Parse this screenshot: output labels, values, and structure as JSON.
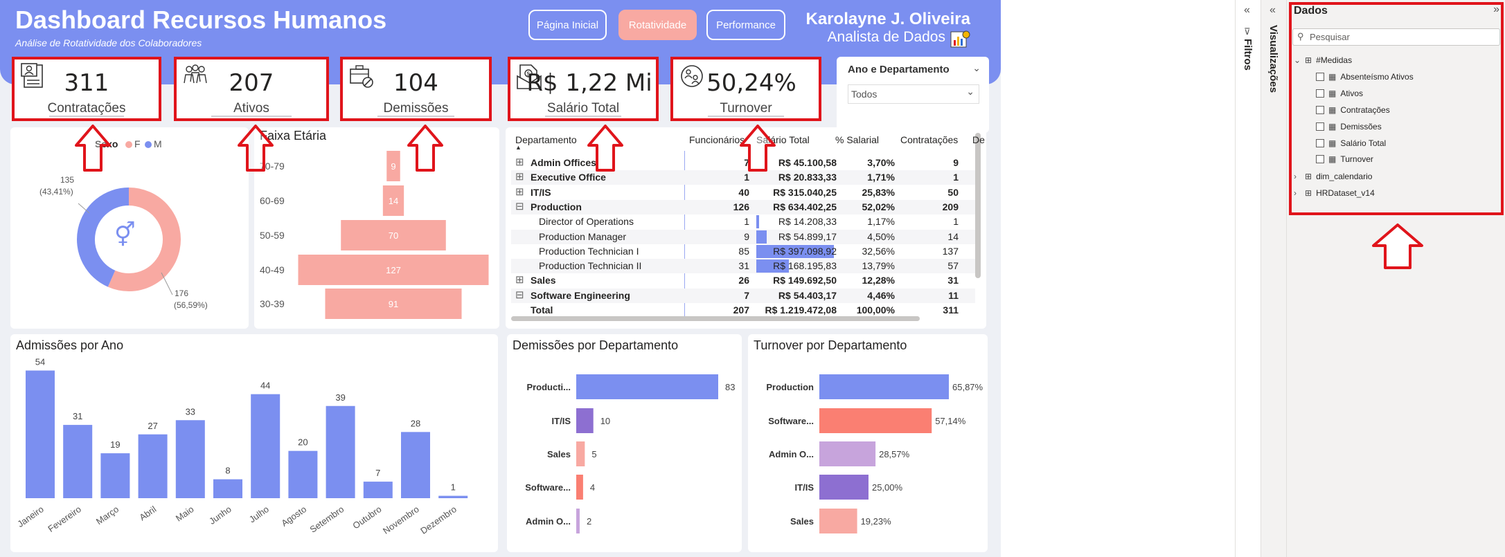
{
  "header": {
    "title": "Dashboard Recursos Humanos",
    "subtitle": "Análise de Rotatividade dos Colaboradores",
    "nav": [
      {
        "label": "Página Inicial",
        "active": false
      },
      {
        "label": "Rotatividade",
        "active": true
      },
      {
        "label": "Performance",
        "active": false
      }
    ],
    "user_name": "Karolayne J. Oliveira",
    "user_role": "Analista de Dados"
  },
  "kpis": [
    {
      "value": "311",
      "label": "Contratações",
      "icon": "hiring-doc-icon"
    },
    {
      "value": "207",
      "label": "Ativos",
      "icon": "people-group-icon"
    },
    {
      "value": "104",
      "label": "Demissões",
      "icon": "briefcase-cancel-icon"
    },
    {
      "value": "R$ 1,22 Mi",
      "label": "Salário Total",
      "icon": "money-doc-icon"
    },
    {
      "value": "50,24%",
      "label": "Turnover",
      "icon": "people-cycle-icon"
    }
  ],
  "slicer": {
    "title": "Ano e Departamento",
    "value": "Todos"
  },
  "sex_chart": {
    "legend_title": "Sexo",
    "legend": [
      {
        "label": "F",
        "color": "#f8a9a2"
      },
      {
        "label": "M",
        "color": "#7b8ff0"
      }
    ],
    "label_m": "135",
    "label_m_pct": "(43,41%)",
    "label_f": "176",
    "label_f_pct": "(56,59%)"
  },
  "age_chart": {
    "title": "Faixa Etária"
  },
  "table": {
    "headers": [
      "Departamento",
      "Funcionários",
      "Salário Total",
      "% Salarial",
      "Contratações",
      "De"
    ],
    "rows": [
      {
        "dept": "Admin Offices",
        "func": "7",
        "sal": "R$ 45.100,58",
        "pct": "3,70%",
        "contr": "9",
        "level": 0,
        "expand": "⊞",
        "bar": 0
      },
      {
        "dept": "Executive Office",
        "func": "1",
        "sal": "R$ 20.833,33",
        "pct": "1,71%",
        "contr": "1",
        "level": 0,
        "expand": "⊞",
        "bar": 0
      },
      {
        "dept": "IT/IS",
        "func": "40",
        "sal": "R$ 315.040,25",
        "pct": "25,83%",
        "contr": "50",
        "level": 0,
        "expand": "⊞",
        "bar": 0
      },
      {
        "dept": "Production",
        "func": "126",
        "sal": "R$ 634.402,25",
        "pct": "52,02%",
        "contr": "209",
        "level": 0,
        "expand": "⊟",
        "bar": 0
      },
      {
        "dept": "Director of Operations",
        "func": "1",
        "sal": "R$ 14.208,33",
        "pct": "1,17%",
        "contr": "1",
        "level": 1,
        "expand": "",
        "bar": 14208.33
      },
      {
        "dept": "Production Manager",
        "func": "9",
        "sal": "R$ 54.899,17",
        "pct": "4,50%",
        "contr": "14",
        "level": 1,
        "expand": "",
        "bar": 54899.17
      },
      {
        "dept": "Production Technician I",
        "func": "85",
        "sal": "R$ 397.098,92",
        "pct": "32,56%",
        "contr": "137",
        "level": 1,
        "expand": "",
        "bar": 397098.92
      },
      {
        "dept": "Production Technician II",
        "func": "31",
        "sal": "R$ 168.195,83",
        "pct": "13,79%",
        "contr": "57",
        "level": 1,
        "expand": "",
        "bar": 168195.83
      },
      {
        "dept": "Sales",
        "func": "26",
        "sal": "R$ 149.692,50",
        "pct": "12,28%",
        "contr": "31",
        "level": 0,
        "expand": "⊞",
        "bar": 0
      },
      {
        "dept": "Software Engineering",
        "func": "7",
        "sal": "R$ 54.403,17",
        "pct": "4,46%",
        "contr": "11",
        "level": 0,
        "expand": "⊟",
        "bar": 0
      },
      {
        "dept": "Total",
        "func": "207",
        "sal": "R$ 1.219.472,08",
        "pct": "100,00%",
        "contr": "311",
        "level": 0,
        "expand": "",
        "bar": 0
      }
    ]
  },
  "chart_titles": {
    "admissions": "Admissões por Ano",
    "dismissals": "Demissões por Departamento",
    "turnover": "Turnover por Departamento"
  },
  "panes": {
    "filters": "Filtros",
    "visualizations": "Visualizações",
    "data": "Dados",
    "search_placeholder": "Pesquisar",
    "tree": [
      {
        "label": "#Medidas",
        "level": 0,
        "kind": "table"
      },
      {
        "label": "Absenteísmo Ativos",
        "level": 1,
        "kind": "measure"
      },
      {
        "label": "Ativos",
        "level": 1,
        "kind": "measure"
      },
      {
        "label": "Contratações",
        "level": 1,
        "kind": "measure"
      },
      {
        "label": "Demissões",
        "level": 1,
        "kind": "measure"
      },
      {
        "label": "Salário Total",
        "level": 1,
        "kind": "measure"
      },
      {
        "label": "Turnover",
        "level": 1,
        "kind": "measure"
      },
      {
        "label": "dim_calendario",
        "level": 0,
        "kind": "table"
      },
      {
        "label": "HRDataset_v14",
        "level": 0,
        "kind": "table"
      }
    ]
  },
  "colors": {
    "blue": "#7b8ff0",
    "pink": "#f8a9a2",
    "salmon": "#fa7f72",
    "purple": "#8d6fd1",
    "lilac": "#c7a4dc",
    "red": "#e0141b"
  },
  "chart_data": [
    {
      "type": "pie",
      "title": "",
      "categories": [
        "F",
        "M"
      ],
      "values": [
        176,
        135
      ],
      "labels": [
        "176 (56,59%)",
        "135 (43,41%)"
      ]
    },
    {
      "type": "bar",
      "orientation": "horizontal",
      "title": "Faixa Etária",
      "categories": [
        "70-79",
        "60-69",
        "50-59",
        "40-49",
        "30-39"
      ],
      "values": [
        9,
        14,
        70,
        127,
        91
      ]
    },
    {
      "type": "bar",
      "title": "Admissões por Ano",
      "categories": [
        "Janeiro",
        "Fevereiro",
        "Março",
        "Abril",
        "Maio",
        "Junho",
        "Julho",
        "Agosto",
        "Setembro",
        "Outubro",
        "Novembro",
        "Dezembro"
      ],
      "values": [
        54,
        31,
        19,
        27,
        33,
        8,
        44,
        20,
        39,
        7,
        28,
        1
      ]
    },
    {
      "type": "bar",
      "orientation": "horizontal",
      "title": "Demissões por Departamento",
      "categories": [
        "Producti...",
        "IT/IS",
        "Sales",
        "Software...",
        "Admin O..."
      ],
      "values": [
        83,
        10,
        5,
        4,
        2
      ],
      "colors": [
        "#7b8ff0",
        "#8d6fd1",
        "#f8a9a2",
        "#fa7f72",
        "#c7a4dc"
      ]
    },
    {
      "type": "bar",
      "orientation": "horizontal",
      "title": "Turnover por Departamento",
      "categories": [
        "Production",
        "Software...",
        "Admin O...",
        "IT/IS",
        "Sales"
      ],
      "values": [
        65.87,
        57.14,
        28.57,
        25.0,
        19.23
      ],
      "labels": [
        "65,87%",
        "57,14%",
        "28,57%",
        "25,00%",
        "19,23%"
      ],
      "colors": [
        "#7b8ff0",
        "#fa7f72",
        "#c7a4dc",
        "#8d6fd1",
        "#f8a9a2"
      ]
    }
  ]
}
